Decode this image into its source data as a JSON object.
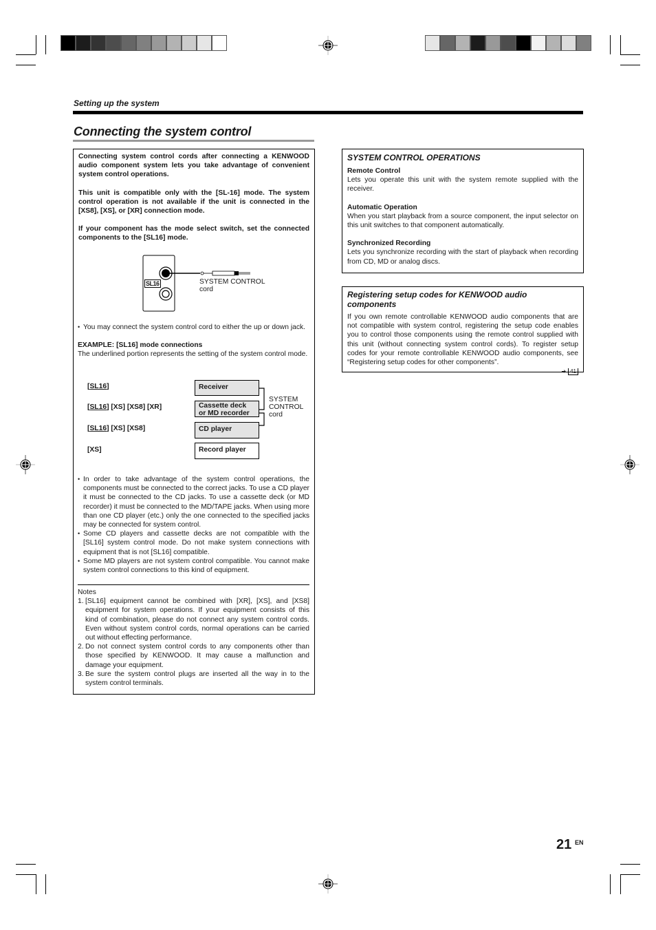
{
  "header": {
    "section_label": "Setting up the system",
    "page_title": "Connecting the system control"
  },
  "print_marks": {
    "colorbar_left": [
      "#000000",
      "#1c1c1c",
      "#333333",
      "#4d4d4d",
      "#666666",
      "#808080",
      "#999999",
      "#b3b3b3",
      "#cccccc",
      "#e6e6e6",
      "#ffffff"
    ],
    "colorbar_right": [
      "#e6e6e6",
      "#666666",
      "#b3b3b3",
      "#1c1c1c",
      "#999999",
      "#4d4d4d",
      "#000000",
      "#f2f2f2",
      "#b3b3b3",
      "#dddddd",
      "#808080"
    ]
  },
  "left_box": {
    "intro_paragraphs": [
      "Connecting system control cords after connecting a KENWOOD audio component system lets you take advantage of convenient system control operations.",
      "This unit is compatible only with the [SL-16] mode. The system control operation is not available if the unit is connected in the [XS8], [XS], or [XR] connection mode.",
      "If your component has the mode select switch, set the connected components to the [SL16] mode."
    ],
    "jack_figure": {
      "panel_label": "SL16",
      "cord_label_line1": "SYSTEM CONTROL",
      "cord_label_line2": "cord"
    },
    "jack_note": "You may connect the system control cord to either the up or down jack.",
    "example_heading": "EXAMPLE: [SL16] mode connections",
    "example_desc": "The underlined portion represents the setting of the system control mode.",
    "connections": [
      {
        "mode_underlined": "SL16",
        "mode_rest": "",
        "component_line1": "Receiver",
        "component_line2": "",
        "shaded": true
      },
      {
        "mode_underlined": "SL16",
        "mode_rest": " [XS] [XS8] [XR]",
        "component_line1": "Cassette deck",
        "component_line2": "or MD recorder",
        "shaded": true
      },
      {
        "mode_underlined": "SL16",
        "mode_rest": " [XS] [XS8]",
        "component_line1": "CD player",
        "component_line2": "",
        "shaded": true
      },
      {
        "mode_plain": "[XS]",
        "component_line1": "Record player",
        "component_line2": "",
        "shaded": false
      }
    ],
    "system_control_label": [
      "SYSTEM",
      "CONTROL",
      "cord"
    ],
    "bullets": [
      "In order to take advantage of the system control operations, the components must be connected to the correct jacks. To use a CD player it must be connected to the CD jacks. To use a cassette deck (or MD recorder) it must be connected to the MD/TAPE jacks. When using more than one CD player (etc.) only the one connected to the specified jacks may be connected for system control.",
      "Some CD players and cassette decks are not compatible with the [SL16] system control mode. Do not make system connections with equipment that is not [SL16] compatible.",
      "Some MD players are not system control compatible. You cannot make system control connections to this kind of equipment."
    ],
    "notes_heading": "Notes",
    "notes": [
      {
        "num": "1.",
        "text": "[SL16] equipment cannot be combined with [XR], [XS], and [XS8] equipment for system operations. If your equipment consists of this kind of combination, please do not connect any system control cords. Even without system control cords, normal operations can be carried out without effecting performance."
      },
      {
        "num": "2.",
        "text": "Do not connect system control cords to any components other than those specified by KENWOOD. It may cause a malfunction and damage your equipment."
      },
      {
        "num": "3.",
        "text": "Be sure the system control plugs are inserted all the way in to the system control terminals."
      }
    ]
  },
  "operations_box": {
    "title": "SYSTEM CONTROL OPERATIONS",
    "items": [
      {
        "heading": "Remote Control",
        "text": "Lets you operate this unit with the system remote supplied with the receiver."
      },
      {
        "heading": "Automatic Operation",
        "text": "When you start playback from a source component, the input selector on this unit switches to that component automatically."
      },
      {
        "heading": "Synchronized Recording",
        "text": "Lets you synchronize recording with the start of playback when recording from CD, MD or analog discs."
      }
    ]
  },
  "registering_box": {
    "title": "Registering setup codes for KENWOOD audio components",
    "text": "If you own remote controllable KENWOOD audio components that are not compatible with system control, registering the setup code enables you to control those components using the remote control supplied with this unit (without connecting system control cords). To register setup codes for your remote controllable KENWOOD audio components, see “Registering setup codes for other components”.",
    "page_ref_arrow": "➔",
    "page_ref": "41"
  },
  "footer": {
    "page_number": "21",
    "language": "EN"
  }
}
